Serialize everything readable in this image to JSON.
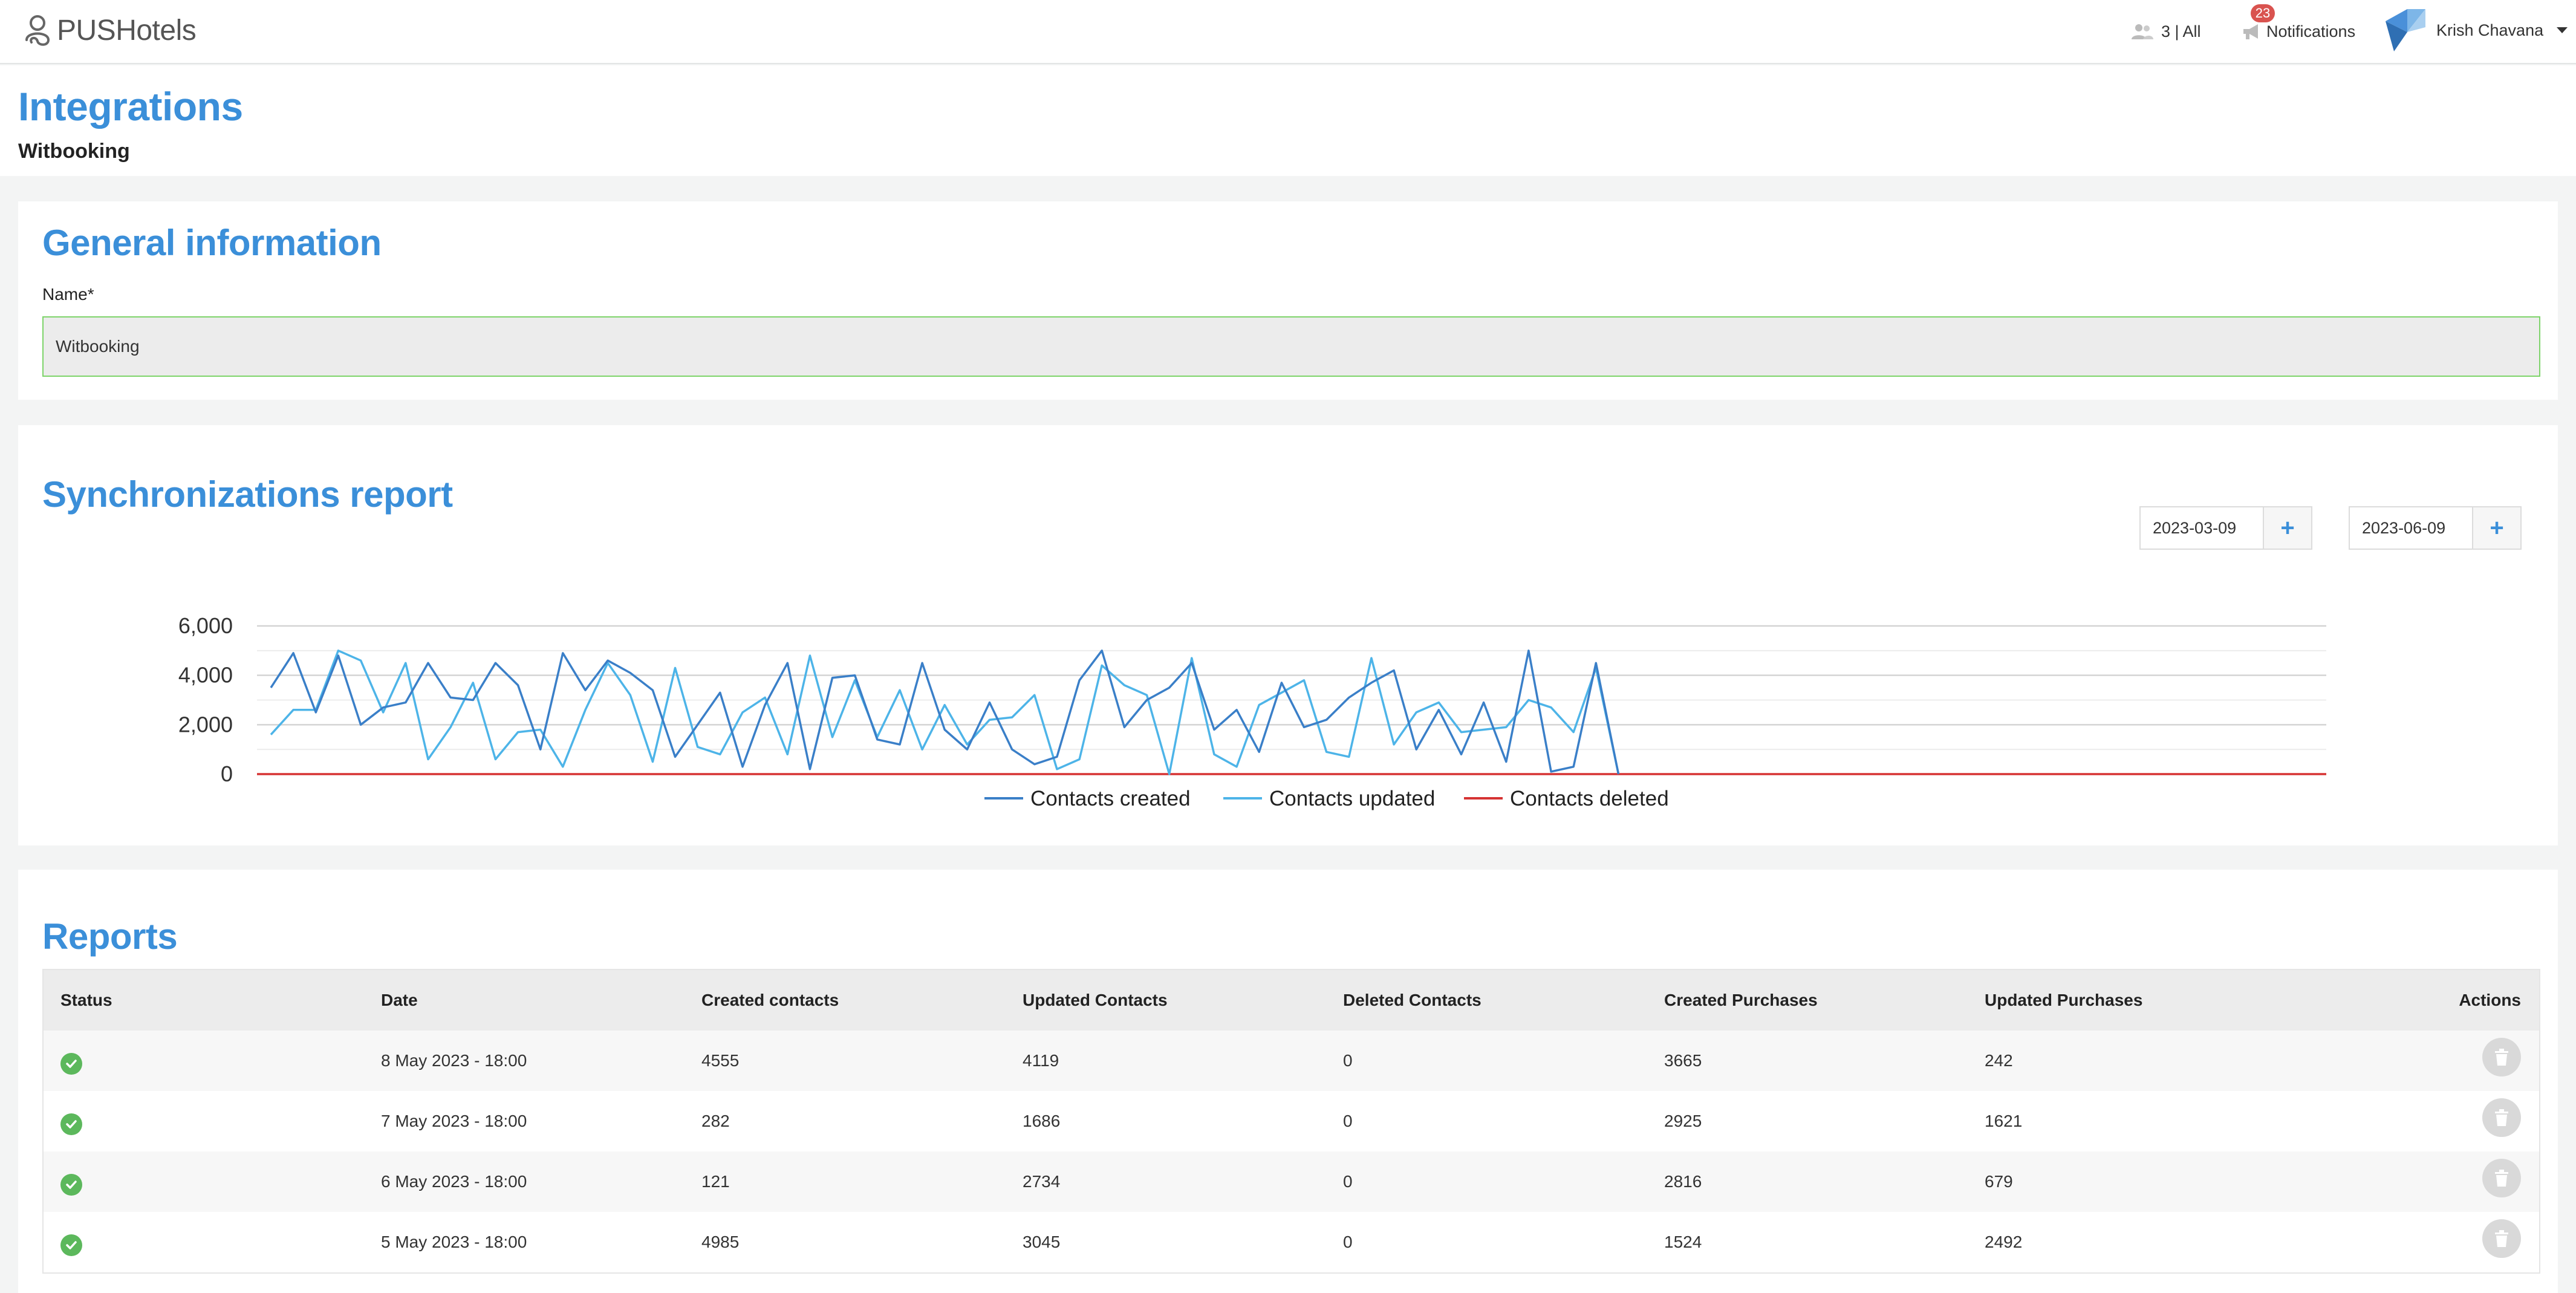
{
  "header": {
    "logo_text": "PUSHotels",
    "users_label": "3 | All",
    "notifications_count": "23",
    "notifications_label": "Notifications",
    "user_name": "Krish Chavana"
  },
  "page": {
    "title": "Integrations",
    "subtitle": "Witbooking"
  },
  "general": {
    "title": "General information",
    "name_label": "Name*",
    "name_value": "Witbooking"
  },
  "sync": {
    "title": "Synchronizations report",
    "date_from": "2023-03-09",
    "date_to": "2023-06-09",
    "add_label": "+"
  },
  "chart_data": {
    "type": "line",
    "ylim": [
      0,
      6000
    ],
    "y_ticks": [
      "0",
      "2,000",
      "4,000",
      "6,000"
    ],
    "x_count": 93,
    "legend_position": "bottom",
    "grid": true,
    "series": [
      {
        "name": "Contacts created",
        "color": "#3a7fc8",
        "values": [
          3500,
          4900,
          2500,
          4800,
          2000,
          2700,
          2900,
          4500,
          3100,
          3000,
          4500,
          3600,
          1000,
          4900,
          3400,
          4600,
          4100,
          3400,
          700,
          2000,
          3300,
          300,
          2800,
          4500,
          200,
          3900,
          4000,
          1400,
          1200,
          4500,
          1800,
          1000,
          2900,
          1000,
          400,
          700,
          3800,
          5000,
          1900,
          3000,
          3500,
          4500,
          1800,
          2600,
          900,
          3700,
          1900,
          2200,
          3100,
          3700,
          4200,
          1000,
          2600,
          800,
          2900,
          500,
          5000,
          100,
          300,
          4500,
          0,
          0,
          0,
          0,
          0,
          0,
          0,
          0,
          0,
          0,
          0,
          0,
          0,
          0,
          0,
          0,
          0,
          0,
          0,
          0,
          0,
          0,
          0,
          0,
          0,
          0,
          0,
          0,
          0,
          0,
          0,
          0,
          0
        ]
      },
      {
        "name": "Contacts updated",
        "color": "#4db4e8",
        "values": [
          1600,
          2600,
          2600,
          5000,
          4600,
          2500,
          4500,
          600,
          1900,
          3700,
          600,
          1700,
          1800,
          300,
          2600,
          4500,
          3200,
          500,
          4300,
          1100,
          800,
          2500,
          3100,
          800,
          4800,
          1500,
          3800,
          1500,
          3400,
          1000,
          2800,
          1200,
          2200,
          2300,
          3200,
          200,
          600,
          4400,
          3600,
          3200,
          0,
          4700,
          800,
          300,
          2800,
          3300,
          3800,
          900,
          700,
          4700,
          1200,
          2500,
          2900,
          1700,
          1800,
          1900,
          3000,
          2700,
          1700,
          4300,
          0,
          0,
          0,
          0,
          0,
          0,
          0,
          0,
          0,
          0,
          0,
          0,
          0,
          0,
          0,
          0,
          0,
          0,
          0,
          0,
          0,
          0,
          0,
          0,
          0,
          0,
          0,
          0,
          0,
          0,
          0,
          0,
          0
        ]
      },
      {
        "name": "Contacts deleted",
        "color": "#d63333",
        "values": [
          0,
          0,
          0,
          0,
          0,
          0,
          0,
          0,
          0,
          0,
          0,
          0,
          0,
          0,
          0,
          0,
          0,
          0,
          0,
          0,
          0,
          0,
          0,
          0,
          0,
          0,
          0,
          0,
          0,
          0,
          0,
          0,
          0,
          0,
          0,
          0,
          0,
          0,
          0,
          0,
          0,
          0,
          0,
          0,
          0,
          0,
          0,
          0,
          0,
          0,
          0,
          0,
          0,
          0,
          0,
          0,
          0,
          0,
          0,
          0,
          0,
          0,
          0,
          0,
          0,
          0,
          0,
          0,
          0,
          0,
          0,
          0,
          0,
          0,
          0,
          0,
          0,
          0,
          0,
          0,
          0,
          0,
          0,
          0,
          0,
          0,
          0,
          0,
          0,
          0,
          0,
          0,
          0
        ]
      }
    ]
  },
  "reports": {
    "title": "Reports",
    "columns": [
      "Status",
      "Date",
      "Created contacts",
      "Updated Contacts",
      "Deleted Contacts",
      "Created Purchases",
      "Updated Purchases",
      "Actions"
    ],
    "rows": [
      {
        "date": "8 May 2023 - 18:00",
        "created_contacts": "4555",
        "updated_contacts": "4119",
        "deleted_contacts": "0",
        "created_purchases": "3665",
        "updated_purchases": "242"
      },
      {
        "date": "7 May 2023 - 18:00",
        "created_contacts": "282",
        "updated_contacts": "1686",
        "deleted_contacts": "0",
        "created_purchases": "2925",
        "updated_purchases": "1621"
      },
      {
        "date": "6 May 2023 - 18:00",
        "created_contacts": "121",
        "updated_contacts": "2734",
        "deleted_contacts": "0",
        "created_purchases": "2816",
        "updated_purchases": "679"
      },
      {
        "date": "5 May 2023 - 18:00",
        "created_contacts": "4985",
        "updated_contacts": "3045",
        "deleted_contacts": "0",
        "created_purchases": "1524",
        "updated_purchases": "2492"
      }
    ]
  },
  "icons": {
    "logo": "pushotels-logo-icon",
    "users": "users-icon",
    "notifications": "megaphone-icon",
    "status": "check-circle-icon",
    "delete": "trash-icon"
  },
  "colors": {
    "accent": "#3b8fd9",
    "success": "#5cb85c",
    "badge": "#d9534f",
    "input_border": "#7ed46a"
  }
}
